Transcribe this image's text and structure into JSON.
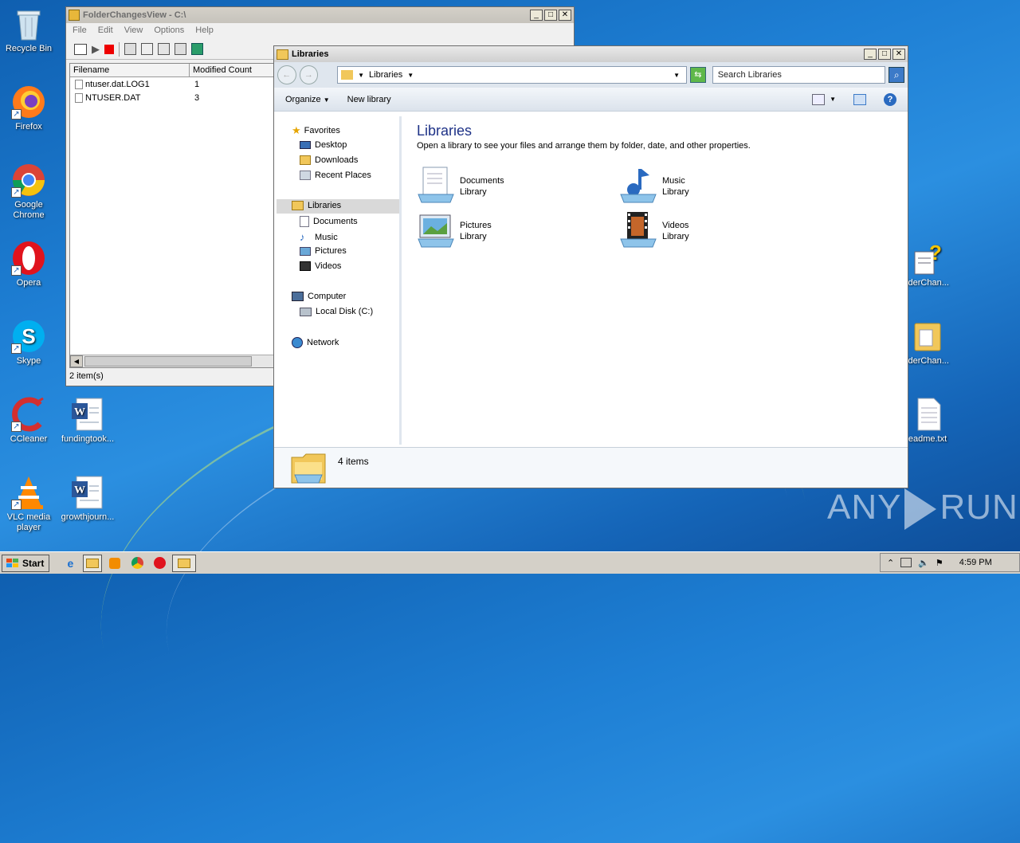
{
  "desktop": {
    "icons_left": [
      {
        "label": "Recycle Bin"
      },
      {
        "label": "Firefox"
      },
      {
        "label": "Google Chrome"
      },
      {
        "label": "Opera"
      },
      {
        "label": "Skype"
      },
      {
        "label": "CCleaner"
      },
      {
        "label": "VLC media player"
      }
    ],
    "icons_docs": [
      {
        "label": "fundingtook..."
      },
      {
        "label": "growthjourn..."
      }
    ],
    "icons_right": [
      {
        "label": "lderChan..."
      },
      {
        "label": "lderChan..."
      },
      {
        "label": "eadme.txt"
      }
    ],
    "watermark": {
      "left": "ANY",
      "right": "RUN"
    }
  },
  "fcv": {
    "title": "FolderChangesView  -  C:\\",
    "menu": [
      "File",
      "Edit",
      "View",
      "Options",
      "Help"
    ],
    "columns": [
      "Filename",
      "Modified Count"
    ],
    "rows": [
      {
        "filename": "ntuser.dat.LOG1",
        "count": "1"
      },
      {
        "filename": "NTUSER.DAT",
        "count": "3"
      }
    ],
    "status": "2 item(s)"
  },
  "explorer": {
    "title": "Libraries",
    "address": "Libraries",
    "search_placeholder": "Search Libraries",
    "organize": "Organize",
    "new_library": "New library",
    "nav": {
      "favorites": "Favorites",
      "favorites_items": [
        "Desktop",
        "Downloads",
        "Recent Places"
      ],
      "libraries": "Libraries",
      "libraries_items": [
        "Documents",
        "Music",
        "Pictures",
        "Videos"
      ],
      "computer": "Computer",
      "computer_items": [
        "Local Disk (C:)"
      ],
      "network": "Network"
    },
    "heading": "Libraries",
    "subheading": "Open a library to see your files and arrange them by folder, date, and other properties.",
    "libraries": [
      {
        "name": "Documents",
        "type": "Library"
      },
      {
        "name": "Music",
        "type": "Library"
      },
      {
        "name": "Pictures",
        "type": "Library"
      },
      {
        "name": "Videos",
        "type": "Library"
      }
    ],
    "details": "4 items"
  },
  "taskbar": {
    "start": "Start",
    "clock": "4:59 PM"
  }
}
